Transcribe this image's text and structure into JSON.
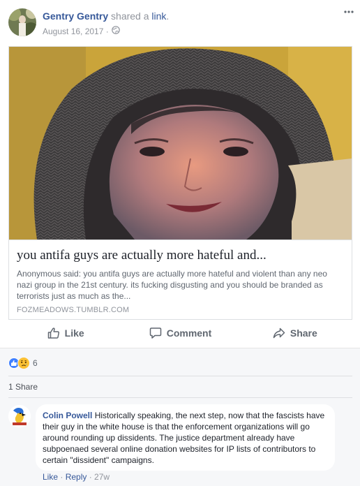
{
  "post": {
    "author": "Gentry Gentry",
    "action_text": "shared a",
    "action_link": "link",
    "action_suffix": ".",
    "date": "August 16, 2017 ·",
    "privacy_icon": "globe-icon",
    "more_icon": "more-dots-icon"
  },
  "shared_link": {
    "title": "you antifa guys are actually more hateful and...",
    "description": "Anonymous said: you antifa guys are actually more hateful and violent than any neo nazi group in the 21st century. its fucking disgusting and you should be branded as terrorists just as much as the...",
    "domain": "FOZMEADOWS.TUMBLR.COM"
  },
  "actions": {
    "like": "Like",
    "comment": "Comment",
    "share": "Share"
  },
  "reactions": {
    "count": "6",
    "types": [
      "like",
      "sad"
    ],
    "shares": "1 Share"
  },
  "comment": {
    "author": "Colin Powell",
    "text": "Historically speaking, the next step, now that the fascists have their guy in the white house is that the enforcement organizations will go around rounding up dissidents. The justice department already have subpoenaed several online donation websites for IP lists of contributors to certain \"dissident\" campaigns.",
    "like_label": "Like",
    "dot1": " · ",
    "reply_label": "Reply",
    "dot2": " · ",
    "time": "27w"
  },
  "colors": {
    "link_blue": "#365899",
    "meta_gray": "#90949c",
    "reaction_blue": "#4080ff",
    "reaction_yellow": "#fcc133",
    "feedback_bg": "#f6f7f9"
  }
}
